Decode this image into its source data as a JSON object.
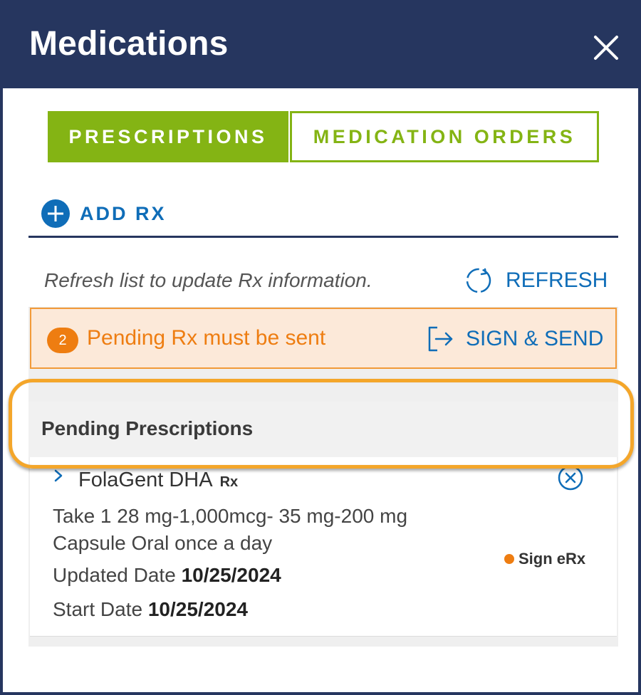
{
  "header": {
    "title": "Medications"
  },
  "tabs": [
    {
      "label": "PRESCRIPTIONS",
      "active": true
    },
    {
      "label": "MEDICATION ORDERS",
      "active": false
    }
  ],
  "add_rx": {
    "label": "ADD RX"
  },
  "refresh": {
    "hint": "Refresh list to update Rx information.",
    "button_label": "REFRESH"
  },
  "pending_banner": {
    "count": "2",
    "message": "Pending Rx must be sent",
    "action_label": "SIGN & SEND"
  },
  "section": {
    "title": "Pending Prescriptions"
  },
  "prescriptions": [
    {
      "name": "FolaGent DHA",
      "tag": "Rx",
      "sig": "Take 1 28 mg-1,000mcg- 35 mg-200 mg Capsule Oral once a day",
      "updated_label": "Updated Date",
      "updated_date": "10/25/2024",
      "start_label": "Start Date",
      "start_date": "10/25/2024",
      "status": "Sign eRx"
    }
  ],
  "colors": {
    "header_bg": "#26365f",
    "tab_green": "#84b414",
    "link_blue": "#0f6db8",
    "pending_orange": "#ee7d11",
    "banner_bg": "#fce9d9",
    "highlight": "#f4a62a"
  },
  "icons": {
    "close": "close-icon",
    "add": "plus-circle-icon",
    "refresh": "refresh-icon",
    "sign_send": "sign-send-icon",
    "expand": "chevron-right-icon",
    "remove": "remove-circle-icon"
  }
}
